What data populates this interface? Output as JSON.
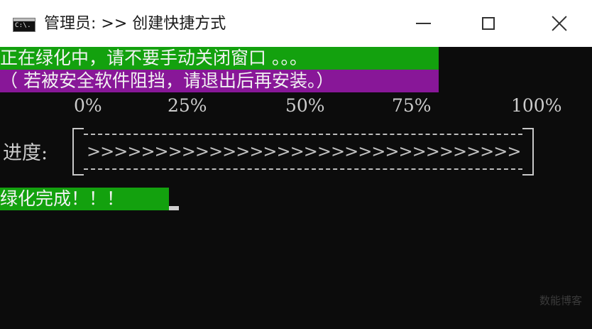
{
  "window": {
    "title": "管理员: >> 创建快捷方式",
    "icon_text": "C:\\.",
    "controls": {
      "minimize_icon": "minimize-icon",
      "maximize_icon": "maximize-icon",
      "close_icon": "close-icon"
    }
  },
  "console": {
    "status_line": "正在绿化中，请不要手动关闭窗口 。。。",
    "warning_line": "（ 若被安全软件阻挡，请退出后再安装。）",
    "status_line_bg": "#13a10e",
    "warning_line_bg": "#881798",
    "ticks": [
      "0%",
      "25%",
      "50%",
      "75%",
      "100%"
    ],
    "progress": {
      "label": "进度:",
      "bar_text": ">>>>>>>>>>>>>>>>>>>>>>>>>>>>>>>>>>>>>>",
      "fraction": 1.0
    },
    "done_line": "绿化完成！！！",
    "done_line_bg": "#13a10e"
  },
  "watermark": "数能博客"
}
